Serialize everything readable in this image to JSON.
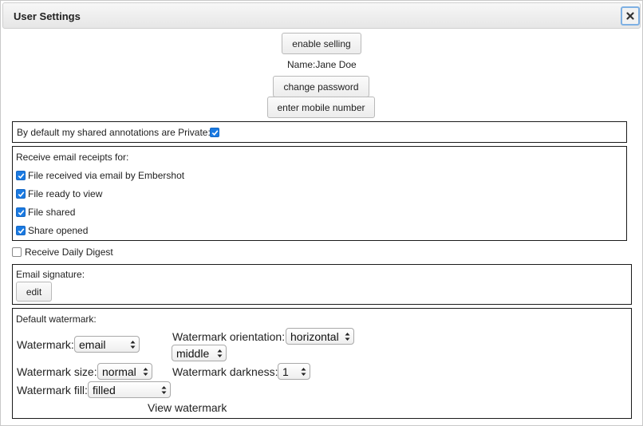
{
  "dialog": {
    "title": "User Settings"
  },
  "account": {
    "enable_selling_label": "enable selling",
    "name_text": "Name:Jane Doe",
    "change_password_label": "change password",
    "enter_mobile_label": "enter mobile number"
  },
  "annotations": {
    "private_label": "By default my shared annotations are Private:",
    "private_checked": true
  },
  "receipts": {
    "heading": "Receive email receipts for:",
    "items": [
      {
        "label": "File received via email by Embershot",
        "checked": true
      },
      {
        "label": "File ready to view",
        "checked": true
      },
      {
        "label": "File shared",
        "checked": true
      },
      {
        "label": "Share opened",
        "checked": true
      }
    ]
  },
  "digest": {
    "label": "Receive Daily Digest",
    "checked": false
  },
  "signature": {
    "heading": "Email signature:",
    "edit_label": "edit"
  },
  "watermark": {
    "heading": "Default watermark:",
    "type_label": "Watermark:",
    "type_value": "email",
    "orientation_label": "Watermark orientation:",
    "orientation_value": "horizontal",
    "position_value": "middle",
    "size_label": "Watermark size:",
    "size_value": "normal",
    "darkness_label": "Watermark darkness:",
    "darkness_value": "1",
    "fill_label": "Watermark fill:",
    "fill_value": "filled",
    "view_label": "View watermark"
  },
  "icons": {
    "close": "close-icon",
    "checkmark": "checkmark-icon",
    "select_arrows": "chevron-up-down-icon"
  },
  "colors": {
    "checkbox_accent": "#1a7ae2",
    "close_focus_ring": "#7eb0e3"
  }
}
